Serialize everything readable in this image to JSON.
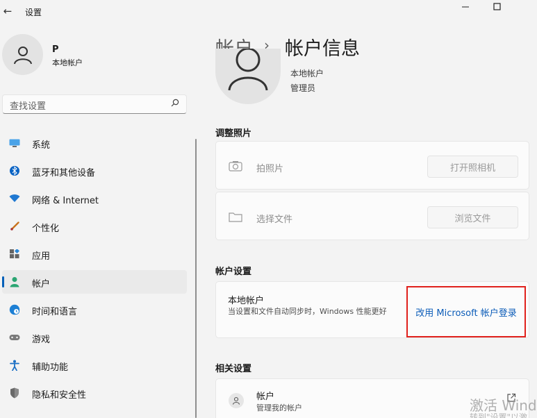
{
  "window": {
    "title": "设置"
  },
  "profile": {
    "name": "P",
    "type": "本地帐户"
  },
  "search": {
    "placeholder": "查找设置"
  },
  "nav": [
    {
      "label": "系统",
      "icon": "monitor-icon",
      "color": "#0078d4"
    },
    {
      "label": "蓝牙和其他设备",
      "icon": "bluetooth-icon",
      "color": "#0067c0"
    },
    {
      "label": "网络 & Internet",
      "icon": "wifi-icon",
      "color": "#1a73c9"
    },
    {
      "label": "个性化",
      "icon": "brush-icon",
      "color": "#c8731e"
    },
    {
      "label": "应用",
      "icon": "apps-icon",
      "color": "#555555"
    },
    {
      "label": "帐户",
      "icon": "person-icon",
      "color": "#2aa572"
    },
    {
      "label": "时间和语言",
      "icon": "globe-clock-icon",
      "color": "#1d7fd4"
    },
    {
      "label": "游戏",
      "icon": "gamepad-icon",
      "color": "#6b6b6b"
    },
    {
      "label": "辅助功能",
      "icon": "accessibility-icon",
      "color": "#1a6fc4"
    },
    {
      "label": "隐私和安全性",
      "icon": "shield-icon",
      "color": "#6b6b6b"
    }
  ],
  "nav_selected": "帐户",
  "breadcrumb": {
    "parent": "帐户",
    "separator": "›",
    "current": "帐户信息"
  },
  "account": {
    "type": "本地帐户",
    "role": "管理员"
  },
  "photo_section": {
    "heading": "调整照片",
    "rows": [
      {
        "label": "拍照片",
        "icon": "camera-icon",
        "button": "打开照相机"
      },
      {
        "label": "选择文件",
        "icon": "folder-icon",
        "button": "浏览文件"
      }
    ]
  },
  "account_settings": {
    "heading": "帐户设置",
    "title": "本地帐户",
    "description": "当设置和文件自动同步时，Windows 性能更好",
    "link": "改用 Microsoft 帐户登录",
    "highlight_color": "#e0201b"
  },
  "related": {
    "heading": "相关设置",
    "title": "帐户",
    "subtitle": "管理我的帐户"
  },
  "watermark": {
    "line1": "激活 Wind",
    "line2": "转到\"设置\"以激"
  }
}
